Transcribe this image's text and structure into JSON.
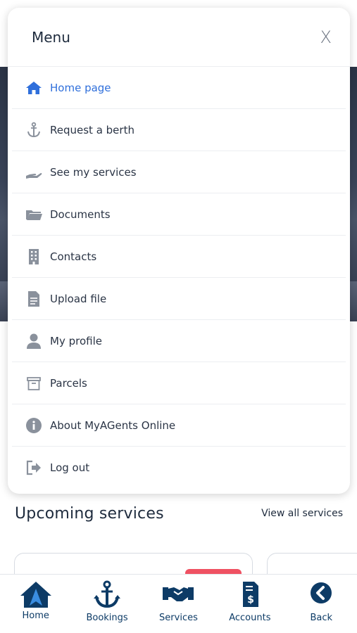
{
  "menu": {
    "title": "Menu",
    "close_label": "X",
    "items": [
      {
        "label": "Home page",
        "icon": "home-icon",
        "active": true
      },
      {
        "label": "Request a berth",
        "icon": "anchor-icon"
      },
      {
        "label": "See my services",
        "icon": "hand-icon"
      },
      {
        "label": "Documents",
        "icon": "folder-icon"
      },
      {
        "label": "Contacts",
        "icon": "building-icon"
      },
      {
        "label": "Upload file",
        "icon": "file-icon"
      },
      {
        "label": "My profile",
        "icon": "user-icon"
      },
      {
        "label": "Parcels",
        "icon": "archive-icon"
      },
      {
        "label": "About MyAGents Online",
        "icon": "info-icon"
      },
      {
        "label": "Log out",
        "icon": "logout-icon"
      }
    ]
  },
  "upcoming": {
    "title": "Upcoming services",
    "view_all": "View all services"
  },
  "bottom_nav": [
    {
      "label": "Home",
      "icon": "home-a-icon"
    },
    {
      "label": "Bookings",
      "icon": "anchor-icon"
    },
    {
      "label": "Services",
      "icon": "handshake-icon"
    },
    {
      "label": "Accounts",
      "icon": "invoice-icon"
    },
    {
      "label": "Back",
      "icon": "back-icon"
    }
  ],
  "colors": {
    "accent": "#2f6fdb",
    "navy": "#0d3b66",
    "icon_gray": "#8a919c",
    "badge": "#ef5162"
  }
}
